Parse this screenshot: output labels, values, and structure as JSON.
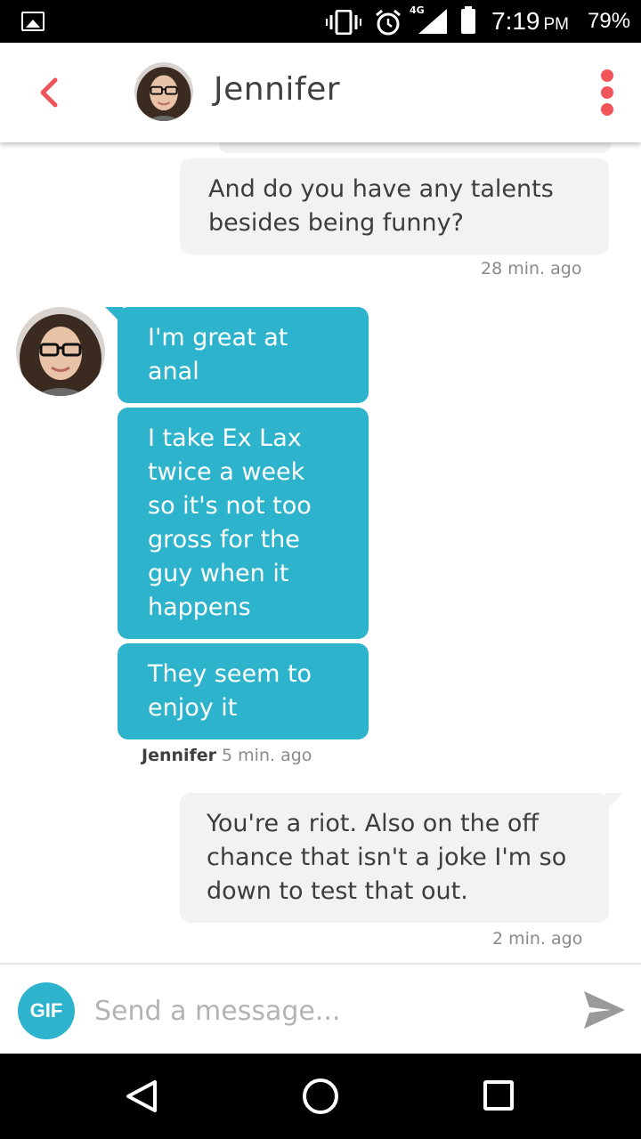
{
  "status_bar": {
    "network_label": "4G",
    "time": "7:19",
    "ampm": "PM",
    "battery": "79%"
  },
  "header": {
    "contact_name": "Jennifer"
  },
  "messages": [
    {
      "direction": "out",
      "text": "And do you have any talents besides being funny?"
    },
    {
      "direction": "in",
      "text": "I'm great at anal"
    },
    {
      "direction": "in",
      "text": "I take Ex Lax twice a week so it's not too gross for the guy when it happens"
    },
    {
      "direction": "in",
      "text": "They seem to enjoy it"
    },
    {
      "direction": "out",
      "text": "You're a riot. Also on the off chance that isn't a joke I'm so down to test that out."
    }
  ],
  "timestamps": {
    "first_out": "28 min. ago",
    "in_sender": "Jennifer",
    "in_time": "5 min. ago",
    "second_out": "2 min. ago"
  },
  "composer": {
    "gif_label": "GIF",
    "placeholder": "Send a message..."
  },
  "colors": {
    "accent": "#f0555a",
    "incoming_bubble": "#2db3cb",
    "outgoing_bubble": "#f2f2f2"
  },
  "icons": {
    "back": "chevron-left-icon",
    "menu": "vertical-dots-icon",
    "send": "paper-plane-icon"
  }
}
